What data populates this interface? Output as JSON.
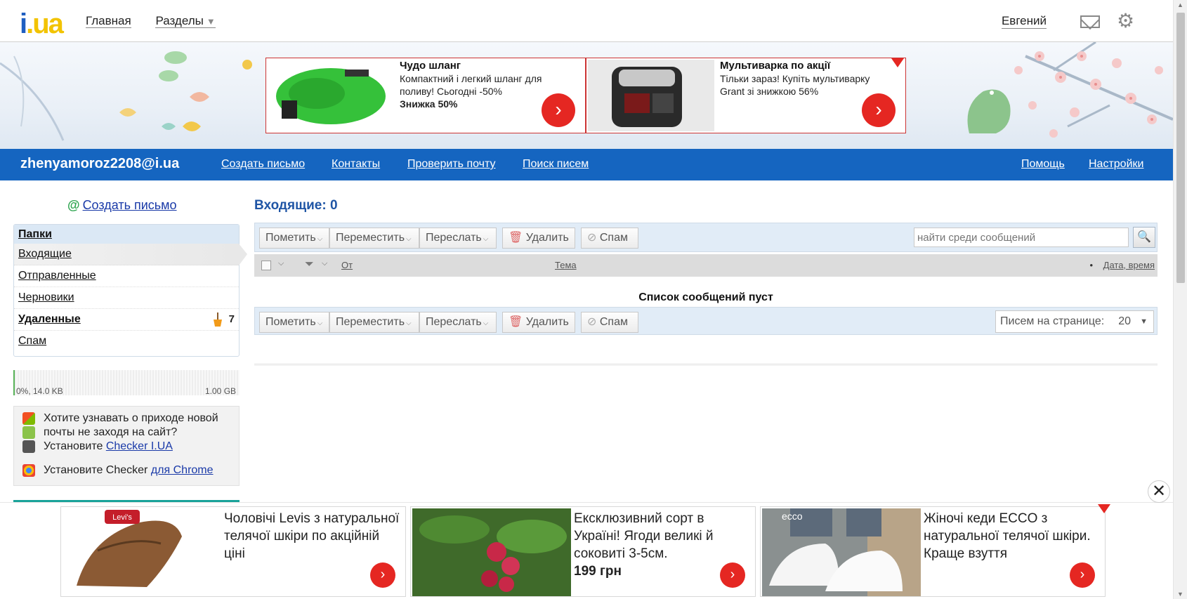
{
  "topbar": {
    "logo_text_i": "i",
    "logo_text_ua": ".ua",
    "nav_home": "Главная",
    "nav_sections": "Разделы",
    "user_name": "Евгений"
  },
  "banner": {
    "ads": [
      {
        "title": "Чудо шланг",
        "text": "Компактний і легкий шланг для поливу! Сьогодні -50%",
        "bold": "Знижка 50%"
      },
      {
        "title": "Мультиварка по акції",
        "text": "Тільки зараз! Купіть мультиварку Grant зі знижкою 56%",
        "bold": ""
      }
    ]
  },
  "bluebar": {
    "email": "zhenyamoroz2208@i.ua",
    "create": "Создать письмо",
    "contacts": "Контакты",
    "check": "Проверить почту",
    "search": "Поиск писем",
    "help": "Помощь",
    "settings": "Настройки"
  },
  "sidebar": {
    "create": "Создать письмо",
    "folders_header": "Папки",
    "folders": [
      {
        "label": "Входящие"
      },
      {
        "label": "Отправленные"
      },
      {
        "label": "Черновики"
      },
      {
        "label": "Удаленные",
        "count": "7"
      },
      {
        "label": "Спам"
      }
    ],
    "quota_left": "0%, 14.0 KB",
    "quota_right": "1.00 GB",
    "quota_used_fraction": 0.0,
    "checker": {
      "line1": "Хотите узнавать о приходе новой почты не заходя на сайт?",
      "install": "Установите ",
      "install_link": "Checker I.UA",
      "install_chrome": "Установите Checker ",
      "chrome_link": "для Chrome"
    }
  },
  "main": {
    "title": "Входящие: 0",
    "toolbar": {
      "mark": "Пометить",
      "move": "Переместить",
      "forward": "Переслать",
      "delete": "Удалить",
      "spam": "Спам",
      "search_placeholder": "найти среди сообщений"
    },
    "columns": {
      "from": "От",
      "subject": "Тема",
      "date": "Дата, время"
    },
    "empty": "Список сообщений пуст",
    "per_page_label": "Писем на странице:",
    "per_page_value": "20"
  },
  "bottom_ads": [
    {
      "text": "Чоловічі Levis з натуральної телячої шкіри по акційній ціні",
      "bold": "",
      "logo": "Levi's"
    },
    {
      "text": "Ексклюзивний сорт в Україні! Ягоди великі й соковиті 3-5см.",
      "bold": "199 грн",
      "logo": ""
    },
    {
      "text": "Жіночі кеди ECCO з натуральної телячої шкіри. Краще взуття",
      "bold": "",
      "logo": "ecco"
    }
  ],
  "colors": {
    "brand_blue": "#1565c0",
    "ad_red": "#e52722",
    "title_blue": "#1f55a5"
  }
}
